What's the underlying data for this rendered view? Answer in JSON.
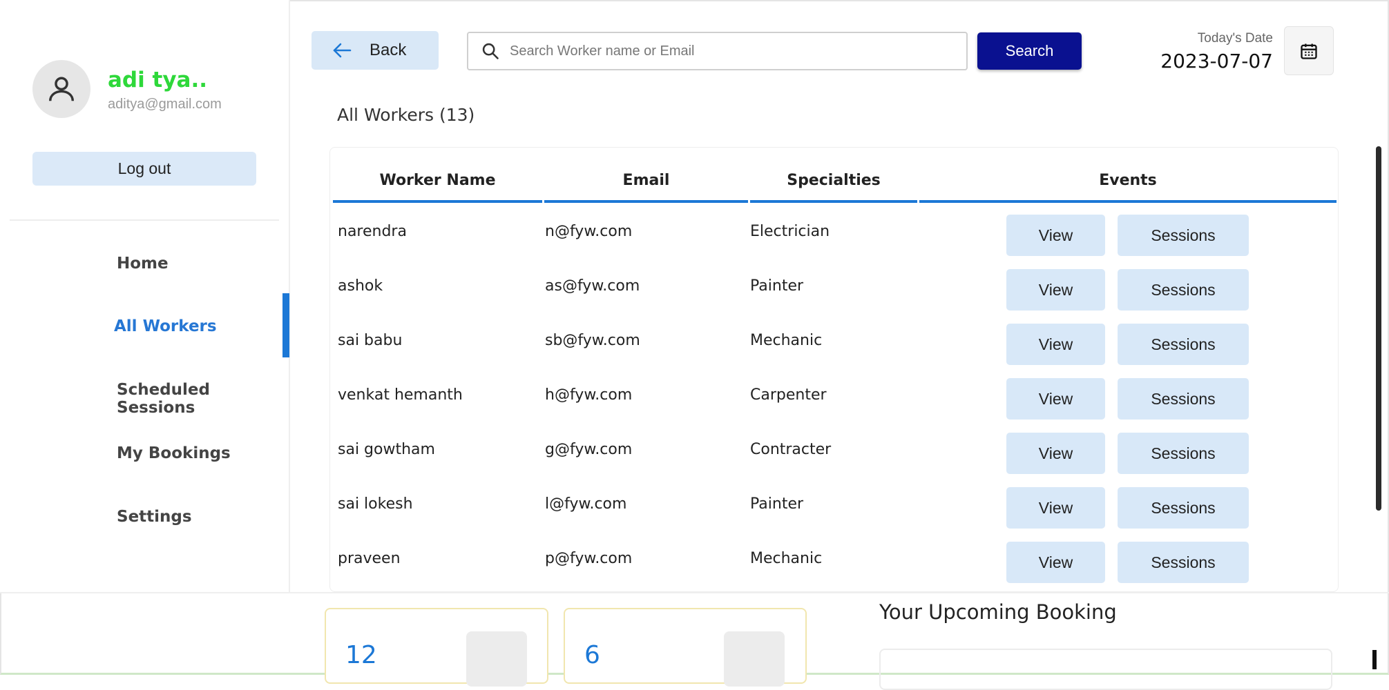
{
  "user": {
    "name": "adi tya..",
    "email": "aditya@gmail.com",
    "logout_label": "Log out"
  },
  "nav": {
    "items": [
      {
        "label": "Home",
        "active": false
      },
      {
        "label": "All Workers",
        "active": true
      },
      {
        "label": "Scheduled Sessions",
        "active": false
      },
      {
        "label": "My Bookings",
        "active": false
      },
      {
        "label": "Settings",
        "active": false
      }
    ]
  },
  "header": {
    "back_label": "Back",
    "search_placeholder": "Search Worker name or Email",
    "search_button": "Search",
    "date_label": "Today's Date",
    "date_value": "2023-07-07"
  },
  "workers": {
    "title": "All Workers (13)",
    "columns": [
      "Worker Name",
      "Email",
      "Specialties",
      "Events"
    ],
    "view_label": "View",
    "sessions_label": "Sessions",
    "rows": [
      {
        "name": "narendra",
        "email": "n@fyw.com",
        "specialty": "Electrician"
      },
      {
        "name": "ashok",
        "email": "as@fyw.com",
        "specialty": "Painter"
      },
      {
        "name": "sai babu",
        "email": "sb@fyw.com",
        "specialty": "Mechanic"
      },
      {
        "name": "venkat hemanth",
        "email": "h@fyw.com",
        "specialty": "Carpenter"
      },
      {
        "name": "sai gowtham",
        "email": "g@fyw.com",
        "specialty": "Contracter"
      },
      {
        "name": "sai lokesh",
        "email": "l@fyw.com",
        "specialty": "Painter"
      },
      {
        "name": "praveen",
        "email": "p@fyw.com",
        "specialty": "Mechanic"
      }
    ]
  },
  "stats": [
    {
      "value": "12"
    },
    {
      "value": "6"
    }
  ],
  "upcoming": {
    "title": "Your Upcoming Booking"
  },
  "colors": {
    "accent": "#1c78d6",
    "search_button": "#0a1190",
    "button_bg": "#d8e8f8",
    "username": "#2ed83a"
  }
}
